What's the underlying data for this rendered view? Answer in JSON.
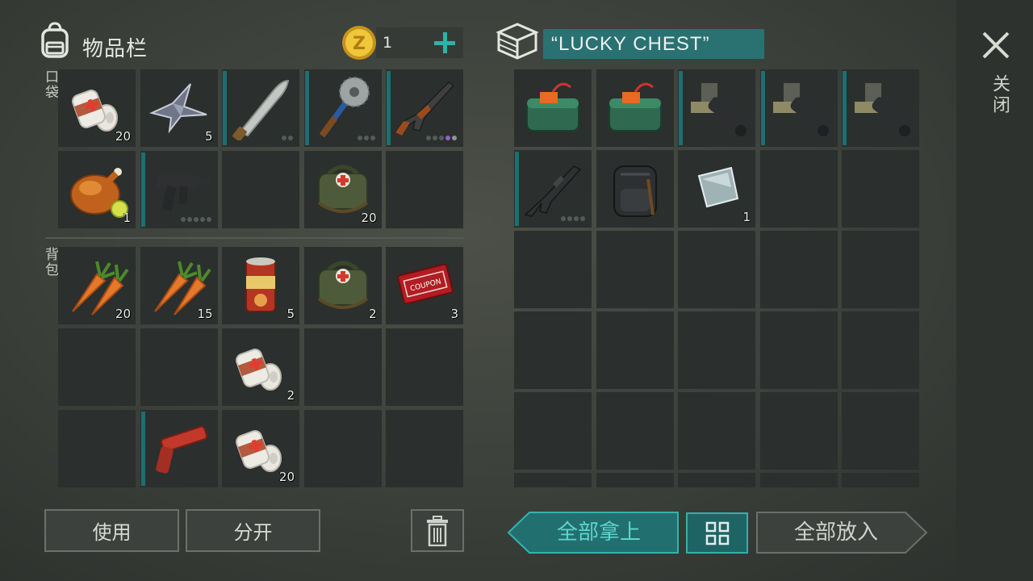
{
  "inventory": {
    "title": "物品栏",
    "coins": "1",
    "pocket_label": "口袋",
    "backpack_label": "背包",
    "pocket_slots": [
      {
        "icon": "bandage-icon",
        "count": "20",
        "durability": false,
        "dots": null
      },
      {
        "icon": "scrap-metal-icon",
        "count": "5",
        "durability": false,
        "dots": null
      },
      {
        "icon": "machete-icon",
        "count": "",
        "durability": true,
        "dots": [
          0,
          0
        ]
      },
      {
        "icon": "saw-mace-icon",
        "count": "",
        "durability": true,
        "dots": [
          0,
          0,
          0
        ]
      },
      {
        "icon": "ak47-icon",
        "count": "",
        "durability": true,
        "dots": [
          0,
          0,
          0,
          2,
          1
        ]
      },
      {
        "icon": "roast-chicken-icon",
        "count": "1",
        "durability": false,
        "dots": null
      },
      {
        "icon": "uzi-icon",
        "count": "",
        "durability": true,
        "dots": [
          0,
          0,
          0,
          0,
          0
        ]
      },
      {
        "icon": "empty",
        "count": "",
        "durability": false,
        "dots": null
      },
      {
        "icon": "medkit-bag-icon",
        "count": "20",
        "durability": false,
        "dots": null
      },
      {
        "icon": "empty",
        "count": "",
        "durability": false,
        "dots": null
      }
    ],
    "backpack_slots": [
      {
        "icon": "carrot-icon",
        "count": "20",
        "durability": false,
        "dots": null
      },
      {
        "icon": "carrot-icon",
        "count": "15",
        "durability": false,
        "dots": null
      },
      {
        "icon": "canned-food-icon",
        "count": "5",
        "durability": false,
        "dots": null
      },
      {
        "icon": "medkit-bag-icon",
        "count": "2",
        "durability": false,
        "dots": null
      },
      {
        "icon": "coupon-icon",
        "count": "3",
        "durability": false,
        "dots": null
      },
      {
        "icon": "empty",
        "count": "",
        "durability": false,
        "dots": null
      },
      {
        "icon": "empty",
        "count": "",
        "durability": false,
        "dots": null
      },
      {
        "icon": "bandage-icon",
        "count": "2",
        "durability": false,
        "dots": null
      },
      {
        "icon": "empty",
        "count": "",
        "durability": false,
        "dots": null
      },
      {
        "icon": "empty",
        "count": "",
        "durability": false,
        "dots": null
      },
      {
        "icon": "empty",
        "count": "",
        "durability": false,
        "dots": null
      },
      {
        "icon": "flare-gun-icon",
        "count": "",
        "durability": true,
        "dots": null
      },
      {
        "icon": "bandage-icon",
        "count": "20",
        "durability": false,
        "dots": null
      },
      {
        "icon": "empty",
        "count": "",
        "durability": false,
        "dots": null
      },
      {
        "icon": "empty",
        "count": "",
        "durability": false,
        "dots": null
      }
    ],
    "use_button": "使用",
    "split_button": "分开"
  },
  "chest": {
    "title": "“LUCKY CHEST”",
    "slots": [
      {
        "icon": "c4-explosive-icon",
        "count": "",
        "durability": false,
        "dots": null
      },
      {
        "icon": "c4-explosive-icon",
        "count": "",
        "durability": false,
        "dots": null
      },
      {
        "icon": "minigun-icon",
        "count": "",
        "durability": true,
        "dots": null
      },
      {
        "icon": "minigun-icon",
        "count": "",
        "durability": true,
        "dots": null
      },
      {
        "icon": "minigun-icon",
        "count": "",
        "durability": true,
        "dots": null
      },
      {
        "icon": "m16-rifle-icon",
        "count": "",
        "durability": true,
        "dots": [
          0,
          0,
          0,
          0
        ]
      },
      {
        "icon": "tactical-backpack-icon",
        "count": "",
        "durability": false,
        "dots": null
      },
      {
        "icon": "steel-plate-icon",
        "count": "1",
        "durability": false,
        "dots": null
      }
    ],
    "take_all_button": "全部拿上",
    "put_all_button": "全部放入"
  },
  "close_label": "关闭",
  "colors": {
    "accent": "#2a9d9a",
    "durability": "#1c6f72",
    "slot": "#2b2f2d",
    "coin": "#e0b52a"
  }
}
